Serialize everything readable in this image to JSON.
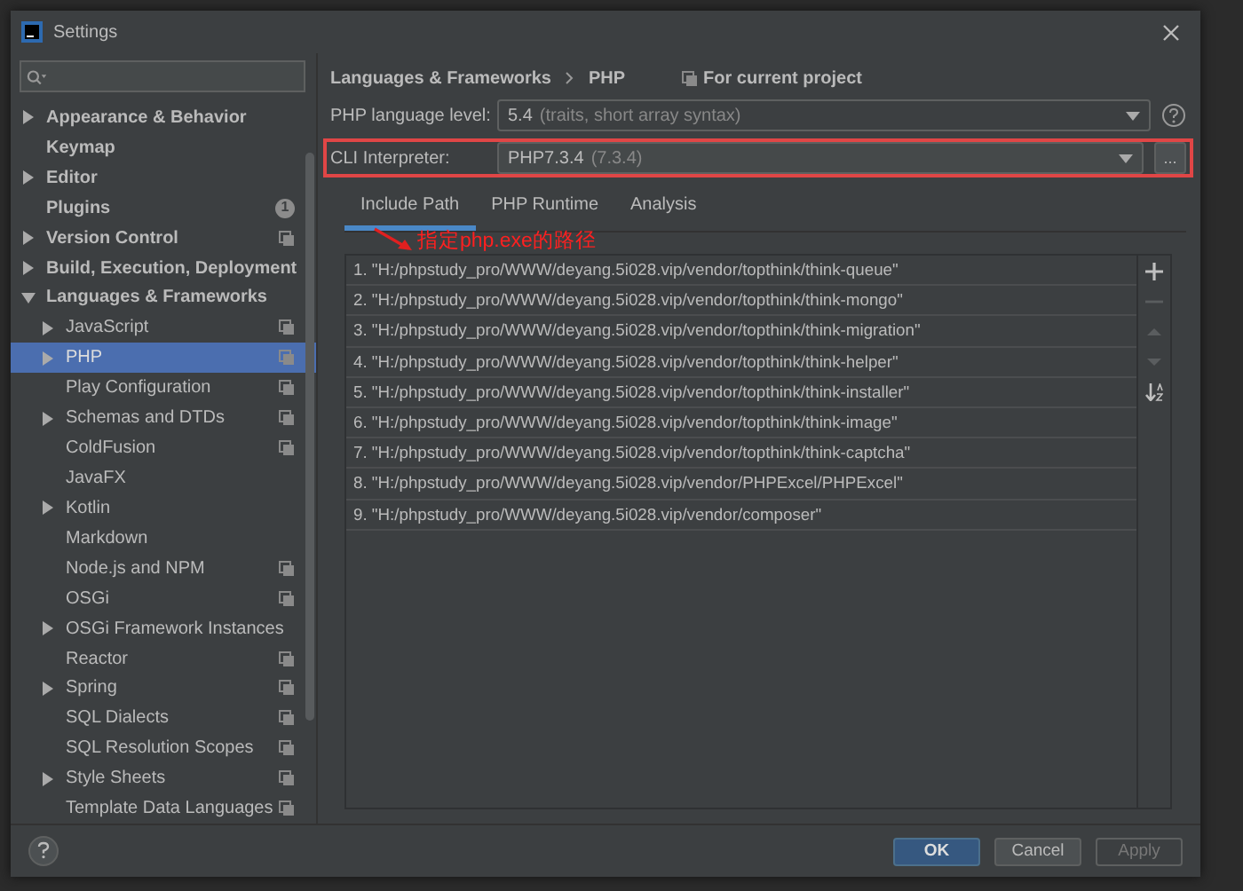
{
  "window": {
    "title": "Settings"
  },
  "sidebar": {
    "items": [
      {
        "label": "Appearance & Behavior",
        "kind": "collapsed",
        "project_scope": false,
        "selected": false
      },
      {
        "label": "Keymap",
        "kind": "leaf",
        "project_scope": false,
        "selected": false
      },
      {
        "label": "Editor",
        "kind": "collapsed",
        "project_scope": false,
        "selected": false
      },
      {
        "label": "Plugins",
        "kind": "leaf",
        "project_scope": false,
        "selected": false,
        "badge": "1"
      },
      {
        "label": "Version Control",
        "kind": "collapsed",
        "project_scope": true,
        "selected": false
      },
      {
        "label": "Build, Execution, Deployment",
        "kind": "collapsed",
        "project_scope": false,
        "selected": false
      },
      {
        "label": "Languages & Frameworks",
        "kind": "expanded",
        "project_scope": false,
        "selected": false,
        "children": [
          {
            "label": "JavaScript",
            "kind": "collapsed",
            "project_scope": true,
            "selected": false
          },
          {
            "label": "PHP",
            "kind": "collapsed",
            "project_scope": true,
            "selected": true
          },
          {
            "label": "Play Configuration",
            "kind": "leaf",
            "project_scope": true,
            "selected": false
          },
          {
            "label": "Schemas and DTDs",
            "kind": "collapsed",
            "project_scope": true,
            "selected": false
          },
          {
            "label": "ColdFusion",
            "kind": "leaf",
            "project_scope": true,
            "selected": false
          },
          {
            "label": "JavaFX",
            "kind": "leaf",
            "project_scope": false,
            "selected": false
          },
          {
            "label": "Kotlin",
            "kind": "collapsed",
            "project_scope": false,
            "selected": false
          },
          {
            "label": "Markdown",
            "kind": "leaf",
            "project_scope": false,
            "selected": false
          },
          {
            "label": "Node.js and NPM",
            "kind": "leaf",
            "project_scope": true,
            "selected": false
          },
          {
            "label": "OSGi",
            "kind": "leaf",
            "project_scope": true,
            "selected": false
          },
          {
            "label": "OSGi Framework Instances",
            "kind": "collapsed",
            "project_scope": false,
            "selected": false
          },
          {
            "label": "Reactor",
            "kind": "leaf",
            "project_scope": true,
            "selected": false
          },
          {
            "label": "Spring",
            "kind": "collapsed",
            "project_scope": true,
            "selected": false
          },
          {
            "label": "SQL Dialects",
            "kind": "leaf",
            "project_scope": true,
            "selected": false
          },
          {
            "label": "SQL Resolution Scopes",
            "kind": "leaf",
            "project_scope": true,
            "selected": false
          },
          {
            "label": "Style Sheets",
            "kind": "collapsed",
            "project_scope": true,
            "selected": false
          },
          {
            "label": "Template Data Languages",
            "kind": "leaf",
            "project_scope": true,
            "selected": false
          }
        ]
      }
    ]
  },
  "breadcrumb": [
    "Languages & Frameworks",
    "PHP"
  ],
  "scope_note": "For current project",
  "language_level": {
    "label": "PHP language level:",
    "value": "5.4",
    "detail": "(traits, short array syntax)"
  },
  "cli_interpreter": {
    "label": "CLI Interpreter:",
    "value": "PHP7.3.4",
    "detail": "(7.3.4)",
    "browse": "...",
    "highlighted": true
  },
  "tabs": [
    {
      "label": "Include Path",
      "selected": true
    },
    {
      "label": "PHP Runtime",
      "selected": false
    },
    {
      "label": "Analysis",
      "selected": false
    }
  ],
  "annotation": {
    "text": "指定php.exe的路径"
  },
  "include_paths": [
    "1. \"H:/phpstudy_pro/WWW/deyang.5i028.vip/vendor/topthink/think-queue\"",
    "2. \"H:/phpstudy_pro/WWW/deyang.5i028.vip/vendor/topthink/think-mongo\"",
    "3. \"H:/phpstudy_pro/WWW/deyang.5i028.vip/vendor/topthink/think-migration\"",
    "4. \"H:/phpstudy_pro/WWW/deyang.5i028.vip/vendor/topthink/think-helper\"",
    "5. \"H:/phpstudy_pro/WWW/deyang.5i028.vip/vendor/topthink/think-installer\"",
    "6. \"H:/phpstudy_pro/WWW/deyang.5i028.vip/vendor/topthink/think-image\"",
    "7. \"H:/phpstudy_pro/WWW/deyang.5i028.vip/vendor/topthink/think-captcha\"",
    "8. \"H:/phpstudy_pro/WWW/deyang.5i028.vip/vendor/PHPExcel/PHPExcel\"",
    "9. \"H:/phpstudy_pro/WWW/deyang.5i028.vip/vendor/composer\""
  ],
  "path_tools": [
    {
      "kind": "add",
      "disabled": false
    },
    {
      "kind": "remove",
      "disabled": true
    },
    {
      "kind": "up",
      "disabled": true
    },
    {
      "kind": "down",
      "disabled": true
    },
    {
      "kind": "sort",
      "disabled": false
    }
  ],
  "buttons": [
    {
      "label": "OK",
      "kind": "primary",
      "disabled": false
    },
    {
      "label": "Cancel",
      "kind": "secondary",
      "disabled": false
    },
    {
      "label": "Apply",
      "kind": "secondary",
      "disabled": true
    }
  ]
}
